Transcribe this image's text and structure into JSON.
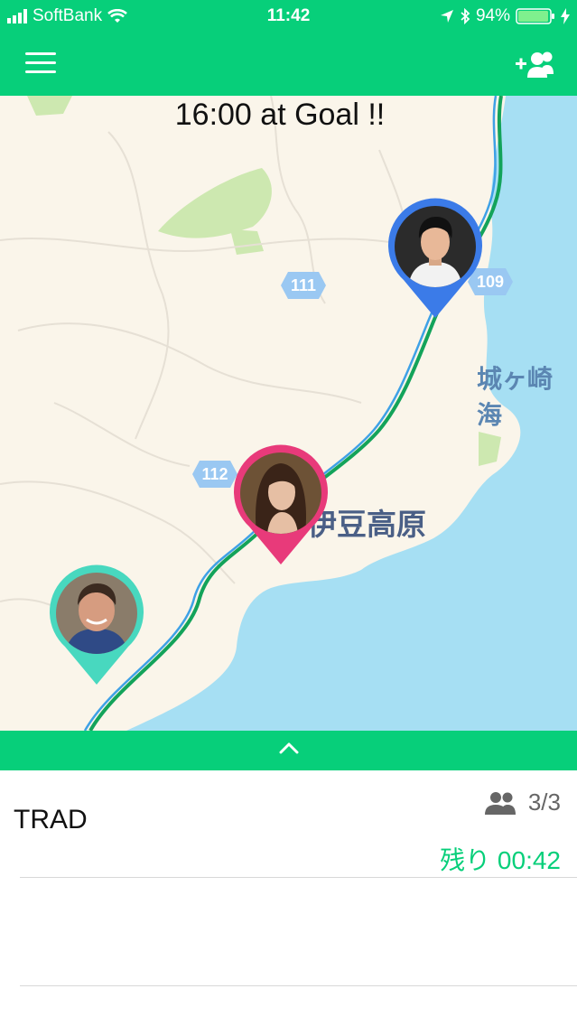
{
  "status_bar": {
    "carrier": "SoftBank",
    "time": "11:42",
    "battery": "94%"
  },
  "nav": {
    "menu_icon": "hamburger-menu-icon",
    "add_member_icon": "add-group-member-icon"
  },
  "map": {
    "goal_banner": "16:00 at Goal !!",
    "place_labels": [
      "城ヶ崎海",
      "伊豆高原"
    ],
    "route_badges": [
      "111",
      "109",
      "112"
    ],
    "pins": [
      {
        "member": "young man",
        "color": "#3b7be8"
      },
      {
        "member": "woman",
        "color": "#e83a7a"
      },
      {
        "member": "older man",
        "color": "#48d8bf"
      }
    ],
    "colors": {
      "land": "#faf5ea",
      "sea": "#a6dff3",
      "park": "#cde8b0",
      "rail": "#13a35a",
      "road": "#3ea1e6"
    }
  },
  "drawer": {
    "toggle_icon": "chevron-up-icon"
  },
  "trip": {
    "name": "TRAD",
    "members_count": "3/3",
    "remaining_label": "残り",
    "remaining_time": "00:42"
  },
  "accent_color": "#07cf7a"
}
